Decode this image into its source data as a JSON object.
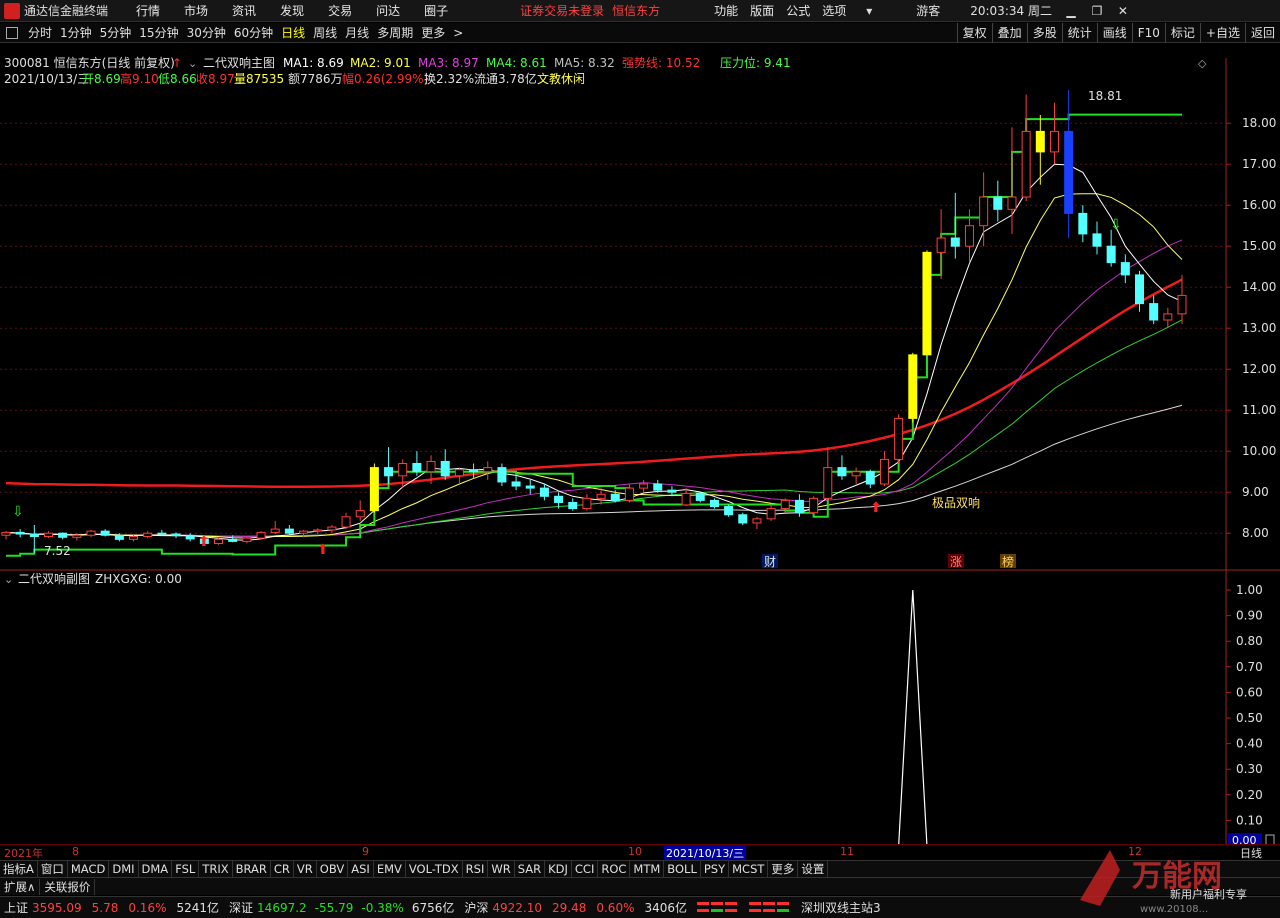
{
  "titlebar": {
    "app_title": "通达信金融终端",
    "menus": [
      "行情",
      "市场",
      "资讯",
      "发现",
      "交易",
      "问达",
      "圈子"
    ],
    "notice": "证券交易未登录",
    "notice_stock": "恒信东方",
    "right_menus": [
      "功能",
      "版面",
      "公式",
      "选项"
    ],
    "guest": "游客",
    "clock": "20:03:34 周二"
  },
  "periodbar": {
    "periods": [
      "分时",
      "1分钟",
      "5分钟",
      "15分钟",
      "30分钟",
      "60分钟",
      "日线",
      "周线",
      "月线",
      "多周期",
      "更多"
    ],
    "active": "日线",
    "tools": [
      "复权",
      "叠加",
      "多股",
      "统计",
      "画线",
      "F10",
      "标记",
      "+自选",
      "返回"
    ]
  },
  "info": {
    "stock": "300081 恒信东方(日线 前复权)",
    "indicator_name": "二代双响主图",
    "ma1": "MA1: 8.69",
    "ma2": "MA2: 9.01",
    "ma3": "MA3: 8.97",
    "ma4": "MA4: 8.61",
    "ma5": "MA5: 8.32",
    "strong_line": "强势线: 10.52",
    "pressure": "压力位: 9.41",
    "date": "2021/10/13/三",
    "open": "开8.69",
    "high": "高9.10",
    "low": "低8.66",
    "close": "收8.97",
    "volume": "量87535",
    "amount": "额7786万",
    "change": "幅0.26(2.99%)",
    "turnover": "换2.32%",
    "float": "流通3.78亿",
    "concept": "文教休闲"
  },
  "chart_labels": {
    "high_label": "18.81",
    "low_label": "7.52",
    "double_label": "极品双响",
    "tag_cai": "财",
    "tag_zhang": "涨",
    "tag_bang": "榜"
  },
  "sub": {
    "name": "二代双响副图",
    "value": "ZHXGXG: 0.00",
    "current": "0.00"
  },
  "xaxis": {
    "labels": [
      "2021年",
      "8",
      "9",
      "10",
      "2021/10/13/三",
      "11",
      "12",
      "日线"
    ]
  },
  "indbar": {
    "items": [
      "指标A",
      "窗口",
      "MACD",
      "DMI",
      "DMA",
      "FSL",
      "TRIX",
      "BRAR",
      "CR",
      "VR",
      "OBV",
      "ASI",
      "EMV",
      "VOL-TDX",
      "RSI",
      "WR",
      "SAR",
      "KDJ",
      "CCI",
      "ROC",
      "MTM",
      "BOLL",
      "PSY",
      "MCST",
      "更多",
      "设置"
    ]
  },
  "extbar": {
    "items": [
      "扩展∧",
      "关联报价"
    ]
  },
  "statusbar": {
    "sh_name": "上证",
    "sh_val": "3595.09",
    "sh_chg": "5.78",
    "sh_pct": "0.16%",
    "sh_amt": "5241亿",
    "sz_name": "深证",
    "sz_val": "14697.2",
    "sz_chg": "-55.79",
    "sz_pct": "-0.38%",
    "sz_amt": "6756亿",
    "hs_name": "沪深",
    "hs_val": "4922.10",
    "hs_chg": "29.48",
    "hs_pct": "0.60%",
    "hs_amt": "3406亿",
    "server": "深圳双线主站3"
  },
  "watermark": {
    "brand": "万能网",
    "slogan": "新用户福利专享",
    "url": "www.20108..."
  },
  "chart_data": {
    "type": "candlestick",
    "ylim": [
      7.2,
      19.2
    ],
    "yticks": [
      "18.00",
      "17.00",
      "16.00",
      "15.00",
      "14.00",
      "13.00",
      "12.00",
      "11.00",
      "10.00",
      "9.00",
      "8.00"
    ],
    "candles": [
      [
        7.95,
        8.05,
        7.85,
        8.02
      ],
      [
        8.02,
        8.1,
        7.9,
        7.98
      ],
      [
        7.98,
        8.2,
        7.52,
        7.92
      ],
      [
        7.92,
        8.05,
        7.88,
        8.0
      ],
      [
        8.0,
        8.02,
        7.85,
        7.9
      ],
      [
        7.9,
        8.0,
        7.82,
        7.95
      ],
      [
        7.95,
        8.08,
        7.9,
        8.05
      ],
      [
        8.05,
        8.1,
        7.92,
        7.95
      ],
      [
        7.95,
        8.0,
        7.8,
        7.85
      ],
      [
        7.85,
        7.98,
        7.8,
        7.92
      ],
      [
        7.92,
        8.05,
        7.88,
        8.0
      ],
      [
        8.0,
        8.08,
        7.94,
        7.98
      ],
      [
        7.98,
        8.02,
        7.88,
        7.94
      ],
      [
        7.94,
        8.0,
        7.8,
        7.86
      ],
      [
        7.86,
        7.92,
        7.7,
        7.75
      ],
      [
        7.75,
        7.9,
        7.72,
        7.85
      ],
      [
        7.85,
        7.95,
        7.78,
        7.8
      ],
      [
        7.8,
        7.92,
        7.76,
        7.88
      ],
      [
        7.88,
        8.05,
        7.85,
        8.02
      ],
      [
        8.02,
        8.3,
        7.98,
        8.1
      ],
      [
        8.1,
        8.2,
        7.95,
        8.0
      ],
      [
        8.0,
        8.08,
        7.9,
        8.05
      ],
      [
        8.05,
        8.12,
        7.98,
        8.08
      ],
      [
        8.08,
        8.2,
        8.0,
        8.15
      ],
      [
        8.15,
        8.5,
        8.1,
        8.4
      ],
      [
        8.4,
        8.8,
        8.3,
        8.55
      ],
      [
        8.55,
        9.7,
        8.5,
        9.6
      ],
      [
        9.6,
        10.1,
        9.2,
        9.4
      ],
      [
        9.4,
        9.8,
        9.1,
        9.7
      ],
      [
        9.7,
        10.0,
        9.4,
        9.5
      ],
      [
        9.5,
        9.9,
        9.2,
        9.75
      ],
      [
        9.75,
        10.05,
        9.3,
        9.4
      ],
      [
        9.4,
        9.6,
        9.2,
        9.55
      ],
      [
        9.55,
        9.7,
        9.35,
        9.5
      ],
      [
        9.5,
        9.75,
        9.3,
        9.6
      ],
      [
        9.6,
        9.7,
        9.15,
        9.25
      ],
      [
        9.25,
        9.4,
        9.05,
        9.15
      ],
      [
        9.15,
        9.3,
        8.95,
        9.1
      ],
      [
        9.1,
        9.2,
        8.8,
        8.9
      ],
      [
        8.9,
        9.0,
        8.6,
        8.75
      ],
      [
        8.75,
        8.85,
        8.55,
        8.6
      ],
      [
        8.6,
        8.95,
        8.55,
        8.85
      ],
      [
        8.85,
        9.1,
        8.7,
        8.95
      ],
      [
        8.95,
        9.05,
        8.75,
        8.8
      ],
      [
        8.8,
        9.2,
        8.75,
        9.1
      ],
      [
        9.1,
        9.3,
        9.0,
        9.2
      ],
      [
        9.2,
        9.3,
        8.98,
        9.05
      ],
      [
        9.05,
        9.15,
        8.9,
        9.0
      ],
      [
        8.69,
        9.1,
        8.66,
        8.97
      ],
      [
        8.97,
        9.0,
        8.75,
        8.8
      ],
      [
        8.8,
        8.85,
        8.6,
        8.65
      ],
      [
        8.65,
        8.7,
        8.4,
        8.45
      ],
      [
        8.45,
        8.5,
        8.2,
        8.25
      ],
      [
        8.25,
        8.4,
        8.1,
        8.35
      ],
      [
        8.35,
        8.7,
        8.3,
        8.6
      ],
      [
        8.6,
        8.85,
        8.5,
        8.8
      ],
      [
        8.8,
        8.95,
        8.4,
        8.5
      ],
      [
        8.5,
        8.9,
        8.45,
        8.85
      ],
      [
        8.85,
        10.1,
        8.8,
        9.6
      ],
      [
        9.6,
        9.9,
        9.3,
        9.4
      ],
      [
        9.4,
        9.6,
        9.2,
        9.5
      ],
      [
        9.5,
        9.55,
        9.1,
        9.2
      ],
      [
        9.2,
        10.0,
        9.15,
        9.8
      ],
      [
        9.8,
        10.9,
        9.7,
        10.8
      ],
      [
        10.8,
        12.4,
        10.7,
        12.35
      ],
      [
        12.35,
        14.9,
        13.3,
        14.85
      ],
      [
        14.85,
        15.9,
        14.2,
        15.2
      ],
      [
        15.2,
        16.3,
        14.7,
        15.0
      ],
      [
        15.0,
        15.9,
        14.6,
        15.5
      ],
      [
        15.5,
        16.8,
        15.0,
        16.2
      ],
      [
        16.2,
        16.6,
        15.6,
        15.9
      ],
      [
        15.9,
        17.9,
        15.3,
        16.2
      ],
      [
        16.2,
        18.7,
        16.1,
        17.8
      ],
      [
        17.8,
        18.2,
        16.5,
        17.3
      ],
      [
        17.3,
        18.5,
        17.0,
        17.8
      ],
      [
        17.8,
        18.81,
        15.2,
        15.8
      ],
      [
        15.8,
        16.0,
        15.1,
        15.3
      ],
      [
        15.3,
        15.6,
        14.8,
        15.0
      ],
      [
        15.0,
        15.4,
        14.5,
        14.6
      ],
      [
        14.6,
        14.8,
        14.1,
        14.3
      ],
      [
        14.3,
        14.4,
        13.4,
        13.6
      ],
      [
        13.6,
        13.8,
        13.1,
        13.2
      ],
      [
        13.2,
        13.5,
        13.0,
        13.35
      ],
      [
        13.35,
        14.3,
        13.1,
        13.8
      ]
    ],
    "sub_ylim": [
      0,
      1.0
    ],
    "sub_yticks": [
      "1.00",
      "0.90",
      "0.80",
      "0.70",
      "0.60",
      "0.50",
      "0.40",
      "0.30",
      "0.20",
      "0.10"
    ]
  }
}
